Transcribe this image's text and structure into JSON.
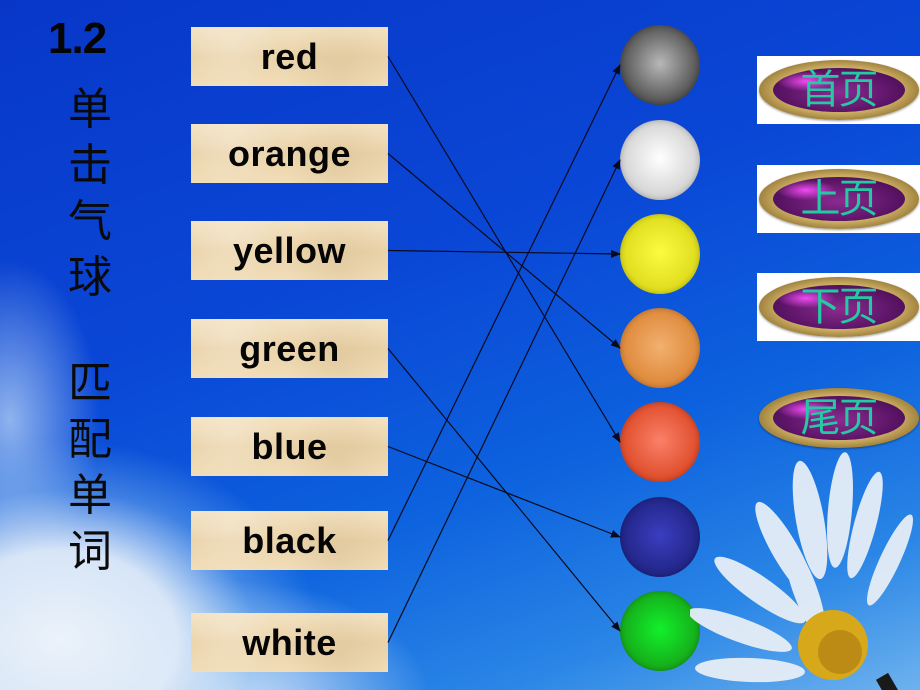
{
  "slide": {
    "number": "1.2",
    "instruction_line1": [
      "单",
      "击",
      "气",
      "球"
    ],
    "instruction_line2": [
      "匹",
      "配",
      "单",
      "词"
    ]
  },
  "words": [
    {
      "id": "red",
      "label": "red"
    },
    {
      "id": "orange",
      "label": "orange"
    },
    {
      "id": "yellow",
      "label": "yellow"
    },
    {
      "id": "green",
      "label": "green"
    },
    {
      "id": "blue",
      "label": "blue"
    },
    {
      "id": "black",
      "label": "black"
    },
    {
      "id": "white",
      "label": "white"
    }
  ],
  "balloons": [
    {
      "id": "black",
      "color": "#3a3a3a",
      "highlight": "#b8b8b8"
    },
    {
      "id": "white",
      "color": "#c8c8c8",
      "highlight": "#ffffff"
    },
    {
      "id": "yellow",
      "color": "#d8d414",
      "highlight": "#fbfb40"
    },
    {
      "id": "orange",
      "color": "#d97f2c",
      "highlight": "#f2b070"
    },
    {
      "id": "red",
      "color": "#d8401c",
      "highlight": "#fa8068"
    },
    {
      "id": "blue",
      "color": "#1b1f78",
      "highlight": "#3a3ec0"
    },
    {
      "id": "green",
      "color": "#179a17",
      "highlight": "#12f02a"
    }
  ],
  "matches": [
    {
      "word": "red",
      "balloon": "red"
    },
    {
      "word": "orange",
      "balloon": "orange"
    },
    {
      "word": "yellow",
      "balloon": "yellow"
    },
    {
      "word": "green",
      "balloon": "green"
    },
    {
      "word": "blue",
      "balloon": "blue"
    },
    {
      "word": "black",
      "balloon": "black"
    },
    {
      "word": "white",
      "balloon": "white"
    }
  ],
  "nav": {
    "first": "首页",
    "prev": "上页",
    "next": "下页",
    "last": "尾页"
  },
  "colors": {
    "background": "#0a47d6",
    "card": "#eed8b0",
    "nav_text": "#25c9a4",
    "arrow": "#0a0a1e"
  }
}
